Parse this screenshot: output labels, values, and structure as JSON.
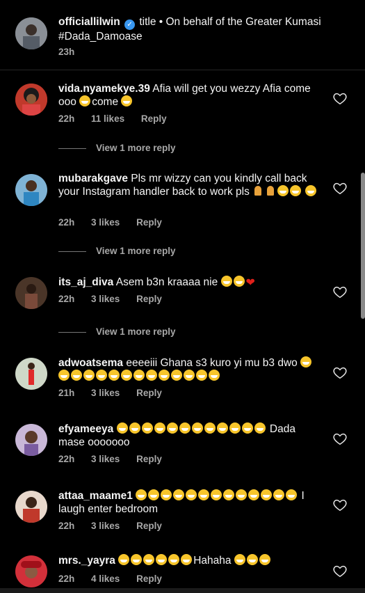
{
  "caption": {
    "username": "officiallilwin",
    "text": "title • On behalf of the Greater Kumasi #Dada_Damoase",
    "time": "23h"
  },
  "comments": [
    {
      "username": "vida.nyamekye.39",
      "text": "Afia will get you wezzy Afia come ooo",
      "text2": "come",
      "time": "22h",
      "likes": "11 likes",
      "reply": "Reply",
      "more": "View 1 more reply"
    },
    {
      "username": "mubarakgave",
      "text": "Pls mr wizzy can you kindly call back your Instagram handler back to work pls",
      "time": "22h",
      "likes": "3 likes",
      "reply": "Reply",
      "more": "View 1 more reply"
    },
    {
      "username": "its_aj_diva",
      "text": "Asem b3n kraaaa nie",
      "time": "22h",
      "likes": "3 likes",
      "reply": "Reply",
      "more": "View 1 more reply"
    },
    {
      "username": "adwoatsema",
      "text": "eeeeiii Ghana s3 kuro yi mu b3 dwo",
      "time": "21h",
      "likes": "3 likes",
      "reply": "Reply"
    },
    {
      "username": "efyameeya",
      "text": "Dada mase ooooooo",
      "time": "22h",
      "likes": "3 likes",
      "reply": "Reply"
    },
    {
      "username": "attaa_maame1",
      "text": "I laugh enter bedroom",
      "time": "22h",
      "likes": "3 likes",
      "reply": "Reply"
    },
    {
      "username": "mrs._yayra",
      "text": "Hahaha",
      "time": "22h",
      "likes": "4 likes",
      "reply": "Reply"
    }
  ],
  "colors": {
    "background": "#000000",
    "meta": "#a8a8a8",
    "verified": "#3897f0"
  }
}
